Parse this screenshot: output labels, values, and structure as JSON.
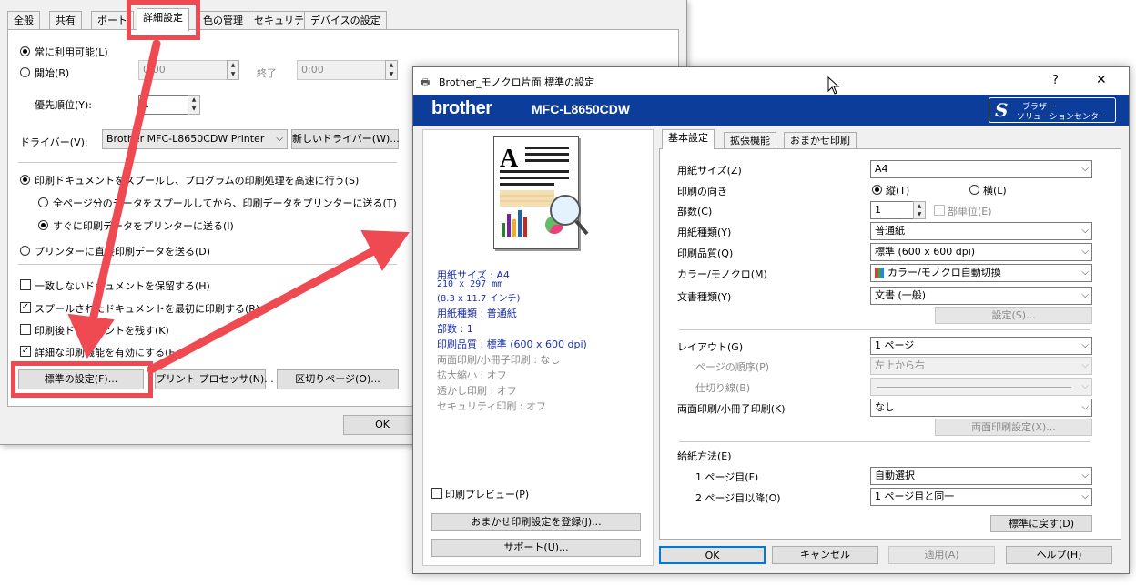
{
  "back_dialog": {
    "tabs": [
      "全般",
      "共有",
      "ポート",
      "詳細設定",
      "色の管理",
      "セキュリティ",
      "デバイスの設定"
    ],
    "always_available": "常に利用可能(L)",
    "start_label": "開始(B)",
    "start_time": "0:00",
    "end_label": "終了",
    "end_time": "0:00",
    "priority_label": "優先順位(Y):",
    "priority_value": "1",
    "driver_label": "ドライバー(V):",
    "driver_value": "Brother MFC-L8650CDW Printer",
    "new_driver_button": "新しいドライバー(W)...",
    "spool_option": "印刷ドキュメントをスプールし、プログラムの印刷処理を高速に行う(S)",
    "spool_all_option": "全ページ分のデータをスプールしてから、印刷データをプリンターに送る(T)",
    "spool_immediate_option": "すぐに印刷データをプリンターに送る(I)",
    "direct_option": "プリンターに直接印刷データを送る(D)",
    "hold_mismatched": "一致しないドキュメントを保留する(H)",
    "print_spooled_first": "スプールされたドキュメントを最初に印刷する(R)",
    "keep_printed": "印刷後ドキュメントを残す(K)",
    "advanced_features": "詳細な印刷機能を有効にする(E)",
    "defaults_button": "標準の設定(F)...",
    "print_processor_button": "プリント プロセッサ(N)...",
    "separator_page_button": "区切りページ(O)...",
    "ok_button": "OK"
  },
  "front_dialog": {
    "title": "Brother_モノクロ片面 標準の設定",
    "help_glyph": "?",
    "close_glyph": "✕",
    "brand": "brother",
    "model": "MFC-L8650CDW",
    "solutions_line1": "ブラザー",
    "solutions_line2": "ソリューションセンター",
    "summary": {
      "paper_size": "用紙サイズ : A4",
      "paper_dims_mm": "210 x 297 mm",
      "paper_dims_in": "(8.3 x 11.7 インチ)",
      "media_type": "用紙種類 : 普通紙",
      "copies": "部数 : 1",
      "quality": "印刷品質 : 標準 (600 x 600 dpi)",
      "duplex": "両面印刷/小冊子印刷 : なし",
      "scaling": "拡大縮小 : オフ",
      "watermark": "透かし印刷 : オフ",
      "secure": "セキュリティ印刷 : オフ"
    },
    "print_preview": "印刷プレビュー(P)",
    "save_profile_button": "おまかせ印刷設定を登録(J)...",
    "support_button": "サポート(U)...",
    "tabs": [
      "基本設定",
      "拡張機能",
      "おまかせ印刷"
    ],
    "labels": {
      "paper_size": "用紙サイズ(Z)",
      "orientation": "印刷の向き",
      "copies": "部数(C)",
      "media_type": "用紙種類(Y)",
      "quality": "印刷品質(Q)",
      "color_mode": "カラー/モノクロ(M)",
      "document_type": "文書種類(Y)",
      "layout": "レイアウト(G)",
      "page_order": "ページの順序(P)",
      "border_line": "仕切り線(B)",
      "duplex": "両面印刷/小冊子印刷(K)",
      "paper_source": "給紙方法(E)",
      "first_page": "1 ページ目(F)",
      "other_pages": "2 ページ目以降(O)"
    },
    "values": {
      "paper_size": "A4",
      "portrait": "縦(T)",
      "landscape": "横(L)",
      "copies": "1",
      "collate": "部単位(E)",
      "media_type": "普通紙",
      "quality": "標準 (600 x 600 dpi)",
      "color_mode": "カラー/モノクロ自動切換",
      "document_type": "文書 (一般)",
      "layout": "1 ページ",
      "page_order": "左上から右",
      "border_line": "",
      "duplex": "なし",
      "first_page": "自動選択",
      "other_pages": "1 ページ目と同一"
    },
    "buttons": {
      "doc_settings": "設定(S)...",
      "duplex_settings": "両面印刷設定(X)...",
      "restore_defaults": "標準に戻す(D)",
      "ok": "OK",
      "cancel": "キャンセル",
      "apply": "適用(A)",
      "help": "ヘルプ(H)"
    }
  },
  "colors": {
    "banner": "#0d3d9a",
    "annotation_red": "#ef4a52",
    "summary_blue": "#1a2fb0"
  }
}
